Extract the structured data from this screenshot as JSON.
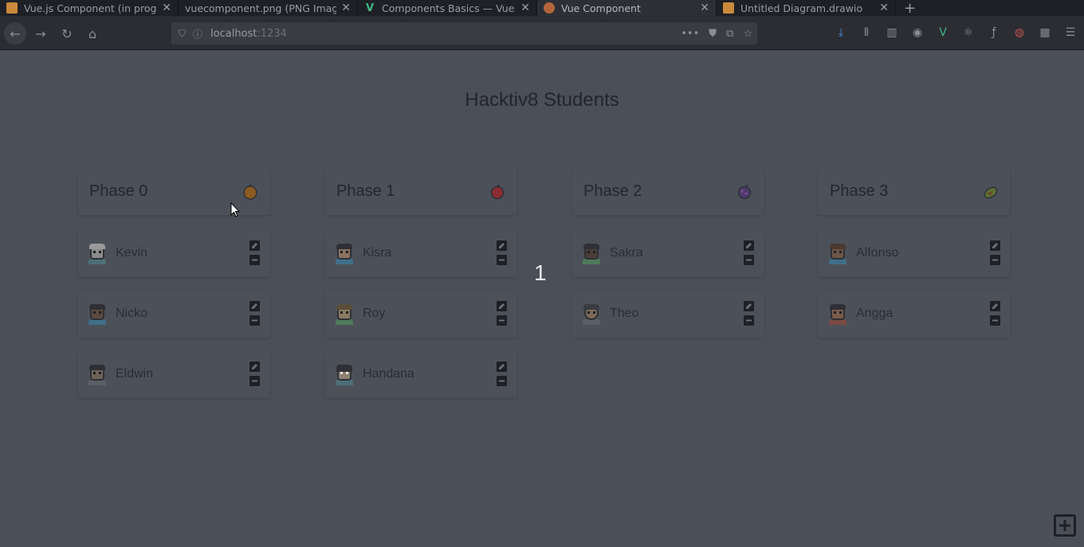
{
  "browser": {
    "tabs": [
      {
        "title": "Vue.js Component (in progress)",
        "favicon_color": "#c98a3b",
        "active": false
      },
      {
        "title": "vuecomponent.png (PNG Image)",
        "favicon_color": "",
        "active": false
      },
      {
        "title": "Components Basics — Vue.js",
        "favicon_color": "#41b883",
        "active": false
      },
      {
        "title": "Vue Component",
        "favicon_color": "#b5653d",
        "active": true
      },
      {
        "title": "Untitled Diagram.drawio",
        "favicon_color": "#c98a3b",
        "active": false
      }
    ],
    "url_host": "localhost",
    "url_port": ":1234"
  },
  "page": {
    "title": "Hacktiv8 Students",
    "counter": "1"
  },
  "phases": [
    {
      "name": "Phase 0",
      "icon": "orange-icon",
      "icon_color": "#c77a2a",
      "students": [
        {
          "name": "Kevin"
        },
        {
          "name": "Nicko"
        },
        {
          "name": "Eldwin"
        }
      ]
    },
    {
      "name": "Phase 1",
      "icon": "apple-icon",
      "icon_color": "#b8323a",
      "students": [
        {
          "name": "Kisra"
        },
        {
          "name": "Roy"
        },
        {
          "name": "Handana"
        }
      ]
    },
    {
      "name": "Phase 2",
      "icon": "grapes-icon",
      "icon_color": "#6a4a8c",
      "students": [
        {
          "name": "Sakra"
        },
        {
          "name": "Theo"
        }
      ]
    },
    {
      "name": "Phase 3",
      "icon": "avocado-icon",
      "icon_color": "#6c8a3a",
      "students": [
        {
          "name": "Alfonso"
        },
        {
          "name": "Angga"
        }
      ]
    }
  ],
  "colors": {
    "overlay_background": "#4a4f58",
    "card_background": "#4c5159",
    "text": "#23262c",
    "button": "#1e2025"
  }
}
